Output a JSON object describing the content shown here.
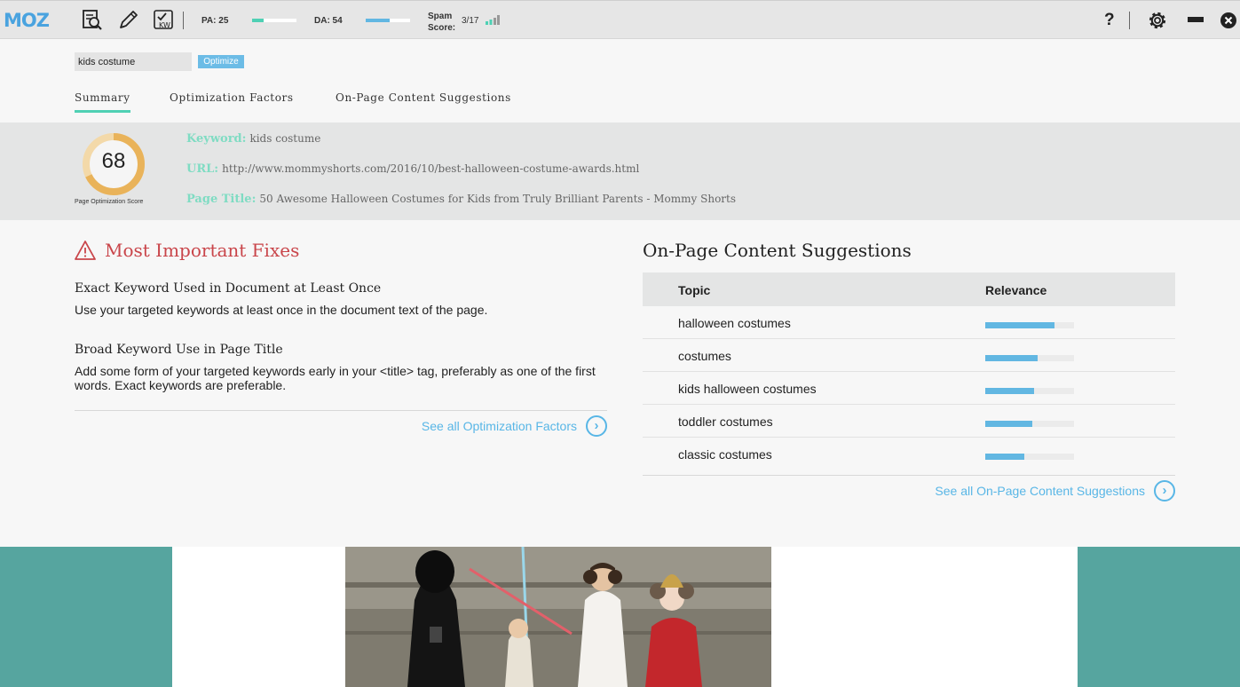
{
  "toolbar": {
    "logo": "MOZ",
    "icons": [
      "page-analysis-icon",
      "highlight-pen-icon",
      "keyword-icon",
      "help-icon",
      "settings-gear-icon",
      "minimize-icon",
      "close-icon"
    ],
    "pa": {
      "label": "PA: 25",
      "value": 25,
      "color": "#4fd0b4"
    },
    "da": {
      "label": "DA: 54",
      "value": 54,
      "color": "#62b7e2"
    },
    "spam": {
      "label_line1": "Spam",
      "label_line2": "Score:",
      "value": "3/17"
    },
    "help": "?"
  },
  "search": {
    "value": "kids costume",
    "button": "Optimize"
  },
  "tabs": [
    {
      "label": "Summary",
      "active": true
    },
    {
      "label": "Optimization Factors",
      "active": false
    },
    {
      "label": "On-Page Content Suggestions",
      "active": false
    }
  ],
  "summary": {
    "score": "68",
    "score_value": 68,
    "score_caption": "Page Optimization Score",
    "keyword_label": "Keyword:",
    "keyword": "kids costume",
    "url_label": "URL:",
    "url": "http://www.mommyshorts.com/2016/10/best-halloween-costume-awards.html",
    "title_label": "Page Title:",
    "title": "50 Awesome Halloween Costumes for Kids from Truly Brilliant Parents - Mommy Shorts"
  },
  "fixes": {
    "title": "Most Important Fixes",
    "items": [
      {
        "title": "Exact Keyword Used in Document at Least Once",
        "desc": "Use your targeted keywords at least once in the document text of the page."
      },
      {
        "title": "Broad Keyword Use in Page Title",
        "desc": "Add some form of your targeted keywords early in your <title> tag, preferably as one of the first words. Exact keywords are preferable."
      }
    ],
    "see_all": "See all Optimization Factors"
  },
  "suggestions": {
    "title": "On-Page Content Suggestions",
    "col_topic": "Topic",
    "col_relevance": "Relevance",
    "rows": [
      {
        "topic": "halloween costumes",
        "relevance": 0.78
      },
      {
        "topic": "costumes",
        "relevance": 0.59
      },
      {
        "topic": "kids halloween costumes",
        "relevance": 0.55
      },
      {
        "topic": "toddler costumes",
        "relevance": 0.53
      },
      {
        "topic": "classic costumes",
        "relevance": 0.44
      }
    ],
    "see_all": "See all On-Page Content Suggestions"
  },
  "colors": {
    "accent_teal": "#4fd0b4",
    "accent_blue": "#62b7e2",
    "score_ring": "#e9b35a",
    "warning_red": "#c9454a",
    "page_teal": "#56a59f"
  }
}
